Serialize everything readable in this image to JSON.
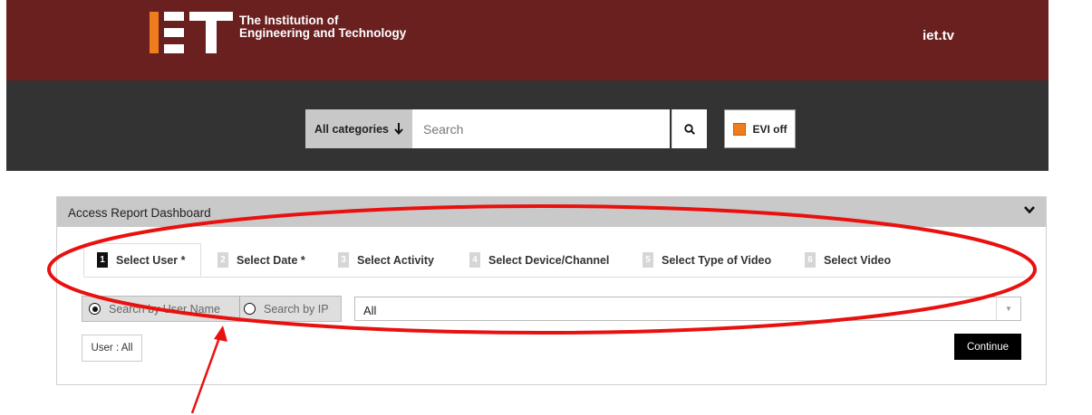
{
  "header": {
    "logo_text_line1": "The Institution of",
    "logo_text_line2": "Engineering and Technology",
    "site_link": "iet.tv",
    "background_color": "#6b2020"
  },
  "search": {
    "category_label": "All categories",
    "category_icon": "arrow-down-icon",
    "placeholder": "Search",
    "search_icon": "magnifier-icon",
    "evi_label": "EVI off",
    "evi_color": "#ef7d1d"
  },
  "dashboard": {
    "title": "Access Report Dashboard",
    "collapse_icon": "chevron-down-icon",
    "steps": [
      {
        "num": "1",
        "label": "Select User *",
        "active": true
      },
      {
        "num": "2",
        "label": "Select Date *",
        "active": false
      },
      {
        "num": "3",
        "label": "Select Activity",
        "active": false
      },
      {
        "num": "4",
        "label": "Select Device/Channel",
        "active": false
      },
      {
        "num": "5",
        "label": "Select Type of Video",
        "active": false
      },
      {
        "num": "6",
        "label": "Select Video",
        "active": false
      }
    ],
    "radio_user_name": "Search by User Name",
    "radio_ip": "Search by IP",
    "selected_radio": "Search by User Name",
    "select_value": "All",
    "user_chip": "User : All",
    "continue_label": "Continue"
  },
  "annotation": {
    "color": "#e8110f"
  }
}
